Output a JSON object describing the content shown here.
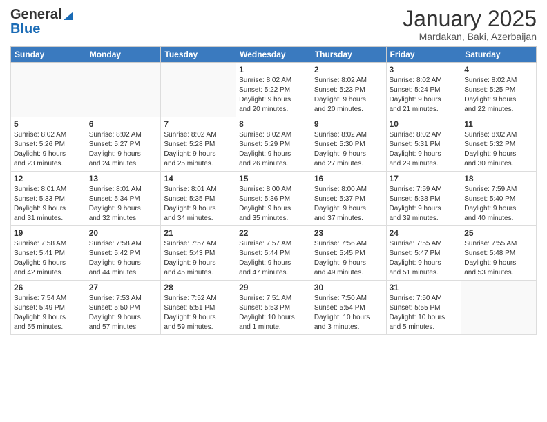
{
  "logo": {
    "general": "General",
    "blue": "Blue"
  },
  "header": {
    "month": "January 2025",
    "location": "Mardakan, Baki, Azerbaijan"
  },
  "weekdays": [
    "Sunday",
    "Monday",
    "Tuesday",
    "Wednesday",
    "Thursday",
    "Friday",
    "Saturday"
  ],
  "weeks": [
    [
      {
        "day": "",
        "text": ""
      },
      {
        "day": "",
        "text": ""
      },
      {
        "day": "",
        "text": ""
      },
      {
        "day": "1",
        "text": "Sunrise: 8:02 AM\nSunset: 5:22 PM\nDaylight: 9 hours\nand 20 minutes."
      },
      {
        "day": "2",
        "text": "Sunrise: 8:02 AM\nSunset: 5:23 PM\nDaylight: 9 hours\nand 20 minutes."
      },
      {
        "day": "3",
        "text": "Sunrise: 8:02 AM\nSunset: 5:24 PM\nDaylight: 9 hours\nand 21 minutes."
      },
      {
        "day": "4",
        "text": "Sunrise: 8:02 AM\nSunset: 5:25 PM\nDaylight: 9 hours\nand 22 minutes."
      }
    ],
    [
      {
        "day": "5",
        "text": "Sunrise: 8:02 AM\nSunset: 5:26 PM\nDaylight: 9 hours\nand 23 minutes."
      },
      {
        "day": "6",
        "text": "Sunrise: 8:02 AM\nSunset: 5:27 PM\nDaylight: 9 hours\nand 24 minutes."
      },
      {
        "day": "7",
        "text": "Sunrise: 8:02 AM\nSunset: 5:28 PM\nDaylight: 9 hours\nand 25 minutes."
      },
      {
        "day": "8",
        "text": "Sunrise: 8:02 AM\nSunset: 5:29 PM\nDaylight: 9 hours\nand 26 minutes."
      },
      {
        "day": "9",
        "text": "Sunrise: 8:02 AM\nSunset: 5:30 PM\nDaylight: 9 hours\nand 27 minutes."
      },
      {
        "day": "10",
        "text": "Sunrise: 8:02 AM\nSunset: 5:31 PM\nDaylight: 9 hours\nand 29 minutes."
      },
      {
        "day": "11",
        "text": "Sunrise: 8:02 AM\nSunset: 5:32 PM\nDaylight: 9 hours\nand 30 minutes."
      }
    ],
    [
      {
        "day": "12",
        "text": "Sunrise: 8:01 AM\nSunset: 5:33 PM\nDaylight: 9 hours\nand 31 minutes."
      },
      {
        "day": "13",
        "text": "Sunrise: 8:01 AM\nSunset: 5:34 PM\nDaylight: 9 hours\nand 32 minutes."
      },
      {
        "day": "14",
        "text": "Sunrise: 8:01 AM\nSunset: 5:35 PM\nDaylight: 9 hours\nand 34 minutes."
      },
      {
        "day": "15",
        "text": "Sunrise: 8:00 AM\nSunset: 5:36 PM\nDaylight: 9 hours\nand 35 minutes."
      },
      {
        "day": "16",
        "text": "Sunrise: 8:00 AM\nSunset: 5:37 PM\nDaylight: 9 hours\nand 37 minutes."
      },
      {
        "day": "17",
        "text": "Sunrise: 7:59 AM\nSunset: 5:38 PM\nDaylight: 9 hours\nand 39 minutes."
      },
      {
        "day": "18",
        "text": "Sunrise: 7:59 AM\nSunset: 5:40 PM\nDaylight: 9 hours\nand 40 minutes."
      }
    ],
    [
      {
        "day": "19",
        "text": "Sunrise: 7:58 AM\nSunset: 5:41 PM\nDaylight: 9 hours\nand 42 minutes."
      },
      {
        "day": "20",
        "text": "Sunrise: 7:58 AM\nSunset: 5:42 PM\nDaylight: 9 hours\nand 44 minutes."
      },
      {
        "day": "21",
        "text": "Sunrise: 7:57 AM\nSunset: 5:43 PM\nDaylight: 9 hours\nand 45 minutes."
      },
      {
        "day": "22",
        "text": "Sunrise: 7:57 AM\nSunset: 5:44 PM\nDaylight: 9 hours\nand 47 minutes."
      },
      {
        "day": "23",
        "text": "Sunrise: 7:56 AM\nSunset: 5:45 PM\nDaylight: 9 hours\nand 49 minutes."
      },
      {
        "day": "24",
        "text": "Sunrise: 7:55 AM\nSunset: 5:47 PM\nDaylight: 9 hours\nand 51 minutes."
      },
      {
        "day": "25",
        "text": "Sunrise: 7:55 AM\nSunset: 5:48 PM\nDaylight: 9 hours\nand 53 minutes."
      }
    ],
    [
      {
        "day": "26",
        "text": "Sunrise: 7:54 AM\nSunset: 5:49 PM\nDaylight: 9 hours\nand 55 minutes."
      },
      {
        "day": "27",
        "text": "Sunrise: 7:53 AM\nSunset: 5:50 PM\nDaylight: 9 hours\nand 57 minutes."
      },
      {
        "day": "28",
        "text": "Sunrise: 7:52 AM\nSunset: 5:51 PM\nDaylight: 9 hours\nand 59 minutes."
      },
      {
        "day": "29",
        "text": "Sunrise: 7:51 AM\nSunset: 5:53 PM\nDaylight: 10 hours\nand 1 minute."
      },
      {
        "day": "30",
        "text": "Sunrise: 7:50 AM\nSunset: 5:54 PM\nDaylight: 10 hours\nand 3 minutes."
      },
      {
        "day": "31",
        "text": "Sunrise: 7:50 AM\nSunset: 5:55 PM\nDaylight: 10 hours\nand 5 minutes."
      },
      {
        "day": "",
        "text": ""
      }
    ]
  ]
}
